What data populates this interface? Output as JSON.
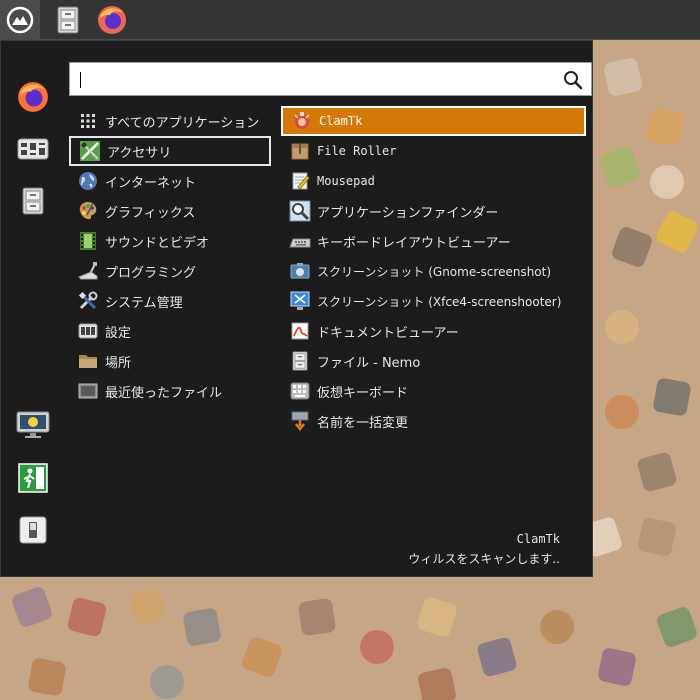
{
  "colors": {
    "panel": "#343434",
    "menu_bg": "#1c1c1c",
    "selection": "#d4780a",
    "text": "#e6e6e6",
    "wallpaper": "#c7a685"
  },
  "panel": {
    "items": [
      {
        "icon": "mint-menu-icon"
      },
      {
        "icon": "file-cabinet-icon"
      },
      {
        "icon": "firefox-icon"
      }
    ]
  },
  "favorites": [
    {
      "icon": "firefox-icon"
    },
    {
      "icon": "control-panel-icon"
    },
    {
      "icon": "file-cabinet-icon"
    },
    {
      "icon": "lock-screen-icon"
    },
    {
      "icon": "logout-icon"
    },
    {
      "icon": "power-switch-icon"
    }
  ],
  "search": {
    "value": "",
    "placeholder": ""
  },
  "categories": [
    {
      "label": "すべてのアプリケーション",
      "icon": "grid-icon"
    },
    {
      "label": "アクセサリ",
      "icon": "accessories-icon"
    },
    {
      "label": "インターネット",
      "icon": "globe-icon"
    },
    {
      "label": "グラフィックス",
      "icon": "palette-icon"
    },
    {
      "label": "サウンドとビデオ",
      "icon": "film-icon"
    },
    {
      "label": "プログラミング",
      "icon": "trowel-icon"
    },
    {
      "label": "システム管理",
      "icon": "tools-icon"
    },
    {
      "label": "設定",
      "icon": "settings-icon"
    },
    {
      "label": "場所",
      "icon": "folder-icon"
    },
    {
      "label": "最近使ったファイル",
      "icon": "recent-icon"
    }
  ],
  "apps": [
    {
      "label": "ClamTk",
      "icon": "clamtk-icon"
    },
    {
      "label": "File Roller",
      "icon": "archive-icon"
    },
    {
      "label": "Mousepad",
      "icon": "notepad-icon"
    },
    {
      "label": "アプリケーションファインダー",
      "icon": "magnifier-icon"
    },
    {
      "label": "キーボードレイアウトビューアー",
      "icon": "keyboard-icon"
    },
    {
      "label": "スクリーンショット (Gnome-screenshot)",
      "icon": "screenshot-icon"
    },
    {
      "label": "スクリーンショット (Xfce4-screenshooter)",
      "icon": "screenshooter-icon"
    },
    {
      "label": "ドキュメントビューアー",
      "icon": "pdf-icon"
    },
    {
      "label": "ファイル - Nemo",
      "icon": "file-cabinet-icon"
    },
    {
      "label": "仮想キーボード",
      "icon": "virtual-keyboard-icon"
    },
    {
      "label": "名前を一括変更",
      "icon": "rename-icon"
    }
  ],
  "description": {
    "title": "ClamTk",
    "text": "ウィルスをスキャンします.."
  }
}
